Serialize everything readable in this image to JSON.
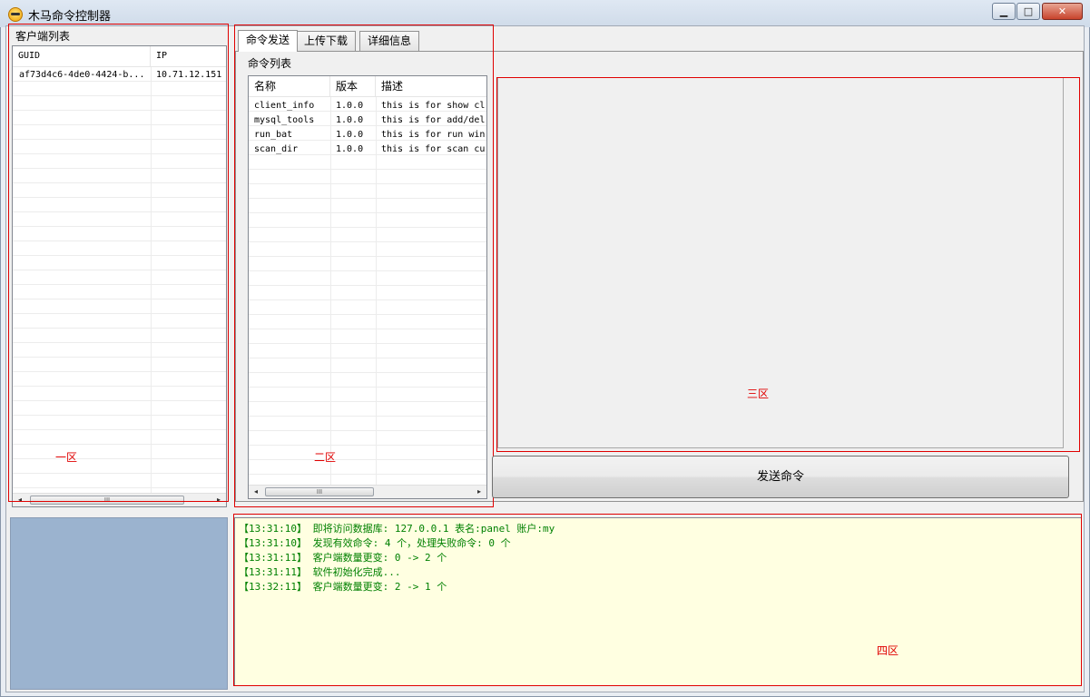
{
  "window": {
    "title": "木马命令控制器",
    "min_label": "▁",
    "max_label": "□",
    "close_label": "✕"
  },
  "clients": {
    "group_label": "客户端列表",
    "columns": [
      "GUID",
      "IP"
    ],
    "rows": [
      {
        "guid": "af73d4c6-4de0-4424-b...",
        "ip": "10.71.12.151"
      }
    ],
    "scroll_thumb": "III"
  },
  "tabs": [
    "命令发送",
    "上传下载",
    "详细信息"
  ],
  "commands": {
    "group_label": "命令列表",
    "columns": [
      "名称",
      "版本",
      "描述"
    ],
    "rows": [
      {
        "name": "client_info",
        "version": "1.0.0",
        "desc": "this is for show cl"
      },
      {
        "name": "mysql_tools",
        "version": "1.0.0",
        "desc": "this is for add/del"
      },
      {
        "name": "run_bat",
        "version": "1.0.0",
        "desc": "this is for run win"
      },
      {
        "name": "scan_dir",
        "version": "1.0.0",
        "desc": "this is for scan cu"
      }
    ],
    "scroll_thumb": "III"
  },
  "send_button": "发送命令",
  "log": [
    "【13:31:10】 即将访问数据库: 127.0.0.1 表名:panel 账户:my",
    "【13:31:10】 发现有效命令: 4 个，处理失败命令: 0 个",
    "【13:31:11】 客户端数量更变: 0 -> 2 个",
    "【13:31:11】 软件初始化完成...",
    "【13:32:11】 客户端数量更变: 2 -> 1 个"
  ],
  "zones": {
    "zone1": "一区",
    "zone2": "二区",
    "zone3": "三区",
    "zone4": "四区"
  },
  "colors": {
    "annotation": "#e00000",
    "log_text": "#008000",
    "log_bg": "#ffffe1"
  }
}
